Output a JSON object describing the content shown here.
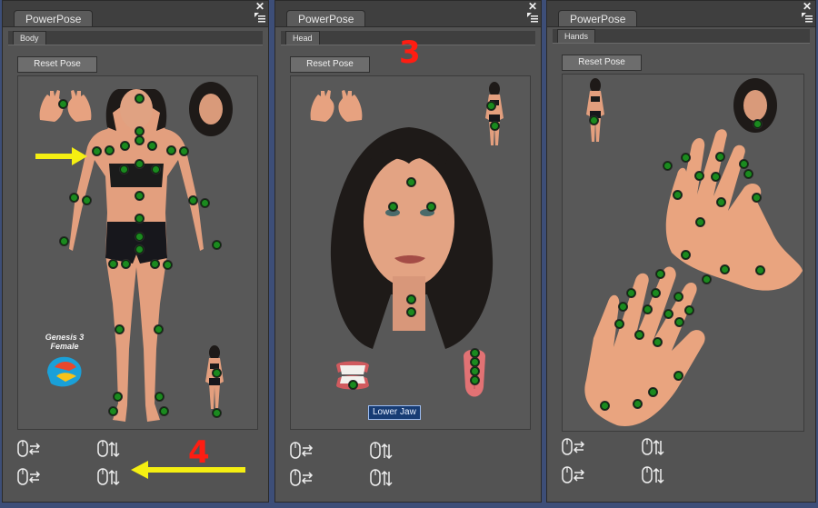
{
  "panels": [
    {
      "title": "PowerPose",
      "subtab": "Body",
      "reset_label": "Reset Pose"
    },
    {
      "title": "PowerPose",
      "subtab": "Head",
      "reset_label": "Reset Pose"
    },
    {
      "title": "PowerPose",
      "subtab": "Hands",
      "reset_label": "Reset Pose"
    }
  ],
  "glyphs": {
    "close": "✕"
  },
  "body_panel": {
    "logo_line1": "Genesis 3",
    "logo_line2": "Female",
    "annotation": "4"
  },
  "head_panel": {
    "tooltip": "Lower Jaw",
    "annotation": "3"
  },
  "icons": {
    "close": "close-icon",
    "menu": "panel-menu-icon",
    "mouse_horizontal": "mouse-left-right-icon",
    "mouse_vertical": "mouse-up-down-icon",
    "annotation_arrow": "yellow-arrow-icon"
  },
  "colors": {
    "annotation_arrow": "#f5ef12",
    "annotation_number": "#ff1d12",
    "control_point": "#1b8a1f",
    "skin": "#e8a27e",
    "hair": "#1e1a18"
  }
}
